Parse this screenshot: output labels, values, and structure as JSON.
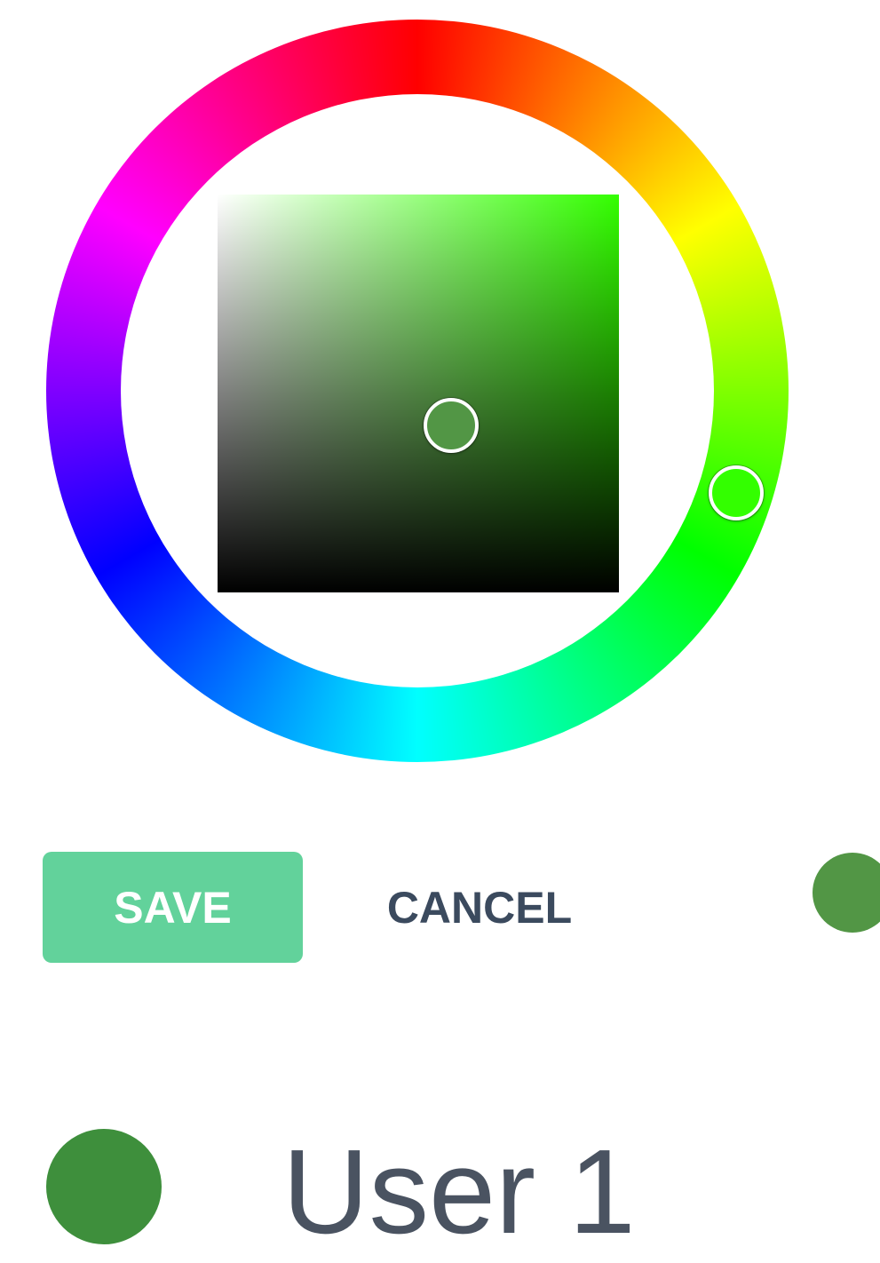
{
  "color_picker": {
    "hue_ring": "hue-ring",
    "selected_hue_color": "#33ff00",
    "selected_color": "#529645"
  },
  "actions": {
    "save_label": "SAVE",
    "cancel_label": "CANCEL",
    "save_color": "#62d29b",
    "cancel_color": "#3b4a5e"
  },
  "user": {
    "name": "User 1",
    "color": "#3e8f3c"
  }
}
